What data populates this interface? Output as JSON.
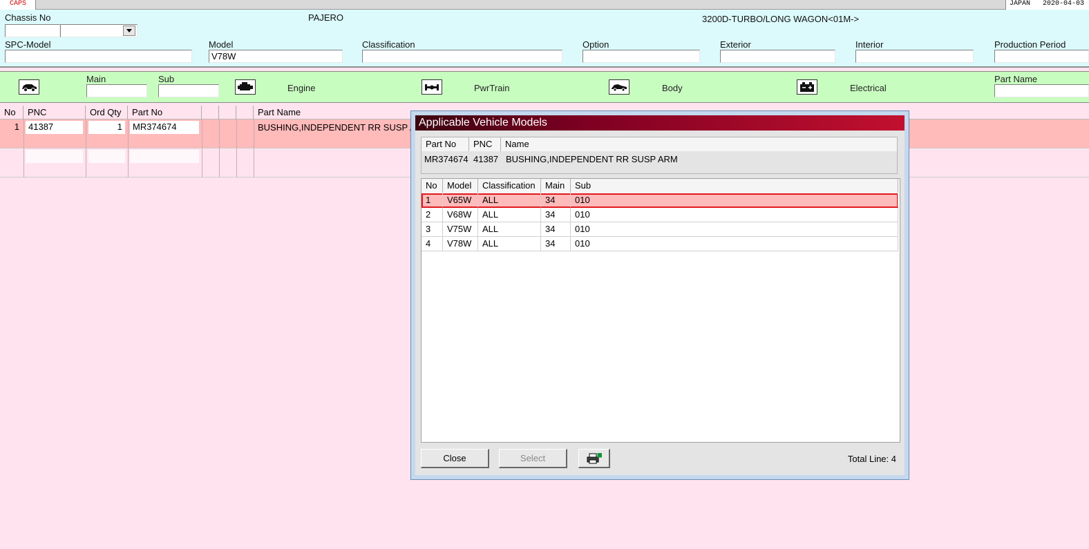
{
  "topbar": {
    "tab": "CAPS",
    "region": "JAPAN",
    "date": "2020-04-03"
  },
  "header": {
    "chassis_label": "Chassis No",
    "vehicle_name": "PAJERO",
    "vehicle_desc": "3200D-TURBO/LONG WAGON<01M->",
    "fields": {
      "spc_model": {
        "label": "SPC-Model",
        "value": ""
      },
      "model": {
        "label": "Model",
        "value": "V78W"
      },
      "classification": {
        "label": "Classification",
        "value": ""
      },
      "option": {
        "label": "Option",
        "value": ""
      },
      "exterior": {
        "label": "Exterior",
        "value": ""
      },
      "interior": {
        "label": "Interior",
        "value": ""
      },
      "production_period": {
        "label": "Production Period",
        "value": ""
      }
    }
  },
  "categories": {
    "main_label": "Main",
    "sub_label": "Sub",
    "engine": "Engine",
    "pwrtrain": "PwrTrain",
    "body": "Body",
    "electrical": "Electrical",
    "part_name_label": "Part Name",
    "icons": [
      "car-icon",
      "engine-icon",
      "drivetrain-icon",
      "body-icon",
      "battery-icon"
    ]
  },
  "grid": {
    "columns": [
      "No",
      "PNC",
      "Ord Qty",
      "Part No",
      "Part Name"
    ],
    "rows": [
      {
        "no": "1",
        "pnc": "41387",
        "qty": "1",
        "part_no": "MR374674",
        "part_name": "BUSHING,INDEPENDENT RR SUSP A"
      }
    ]
  },
  "dialog": {
    "title": "Applicable Vehicle Models",
    "part_header": [
      "Part No",
      "PNC",
      "Name"
    ],
    "part": {
      "part_no": "MR374674",
      "pnc": "41387",
      "name": "BUSHING,INDEPENDENT RR SUSP ARM"
    },
    "model_columns": [
      "No",
      "Model",
      "Classification",
      "Main",
      "Sub"
    ],
    "models": [
      {
        "no": "1",
        "model": "V65W",
        "classification": "ALL",
        "main": "34",
        "sub": "010"
      },
      {
        "no": "2",
        "model": "V68W",
        "classification": "ALL",
        "main": "34",
        "sub": "010"
      },
      {
        "no": "3",
        "model": "V75W",
        "classification": "ALL",
        "main": "34",
        "sub": "010"
      },
      {
        "no": "4",
        "model": "V78W",
        "classification": "ALL",
        "main": "34",
        "sub": "010"
      }
    ],
    "selected_row": 1,
    "close_label": "Close",
    "select_label": "Select",
    "print_icon": "printer-icon",
    "total_line": "Total Line: 4"
  },
  "colors": {
    "header_bg": "#dcfafc",
    "category_bg": "#c8fdc0",
    "grid_bg": "#ffe4ef",
    "selected_row": "#ffbaba",
    "dialog_title": "#c2102f"
  }
}
